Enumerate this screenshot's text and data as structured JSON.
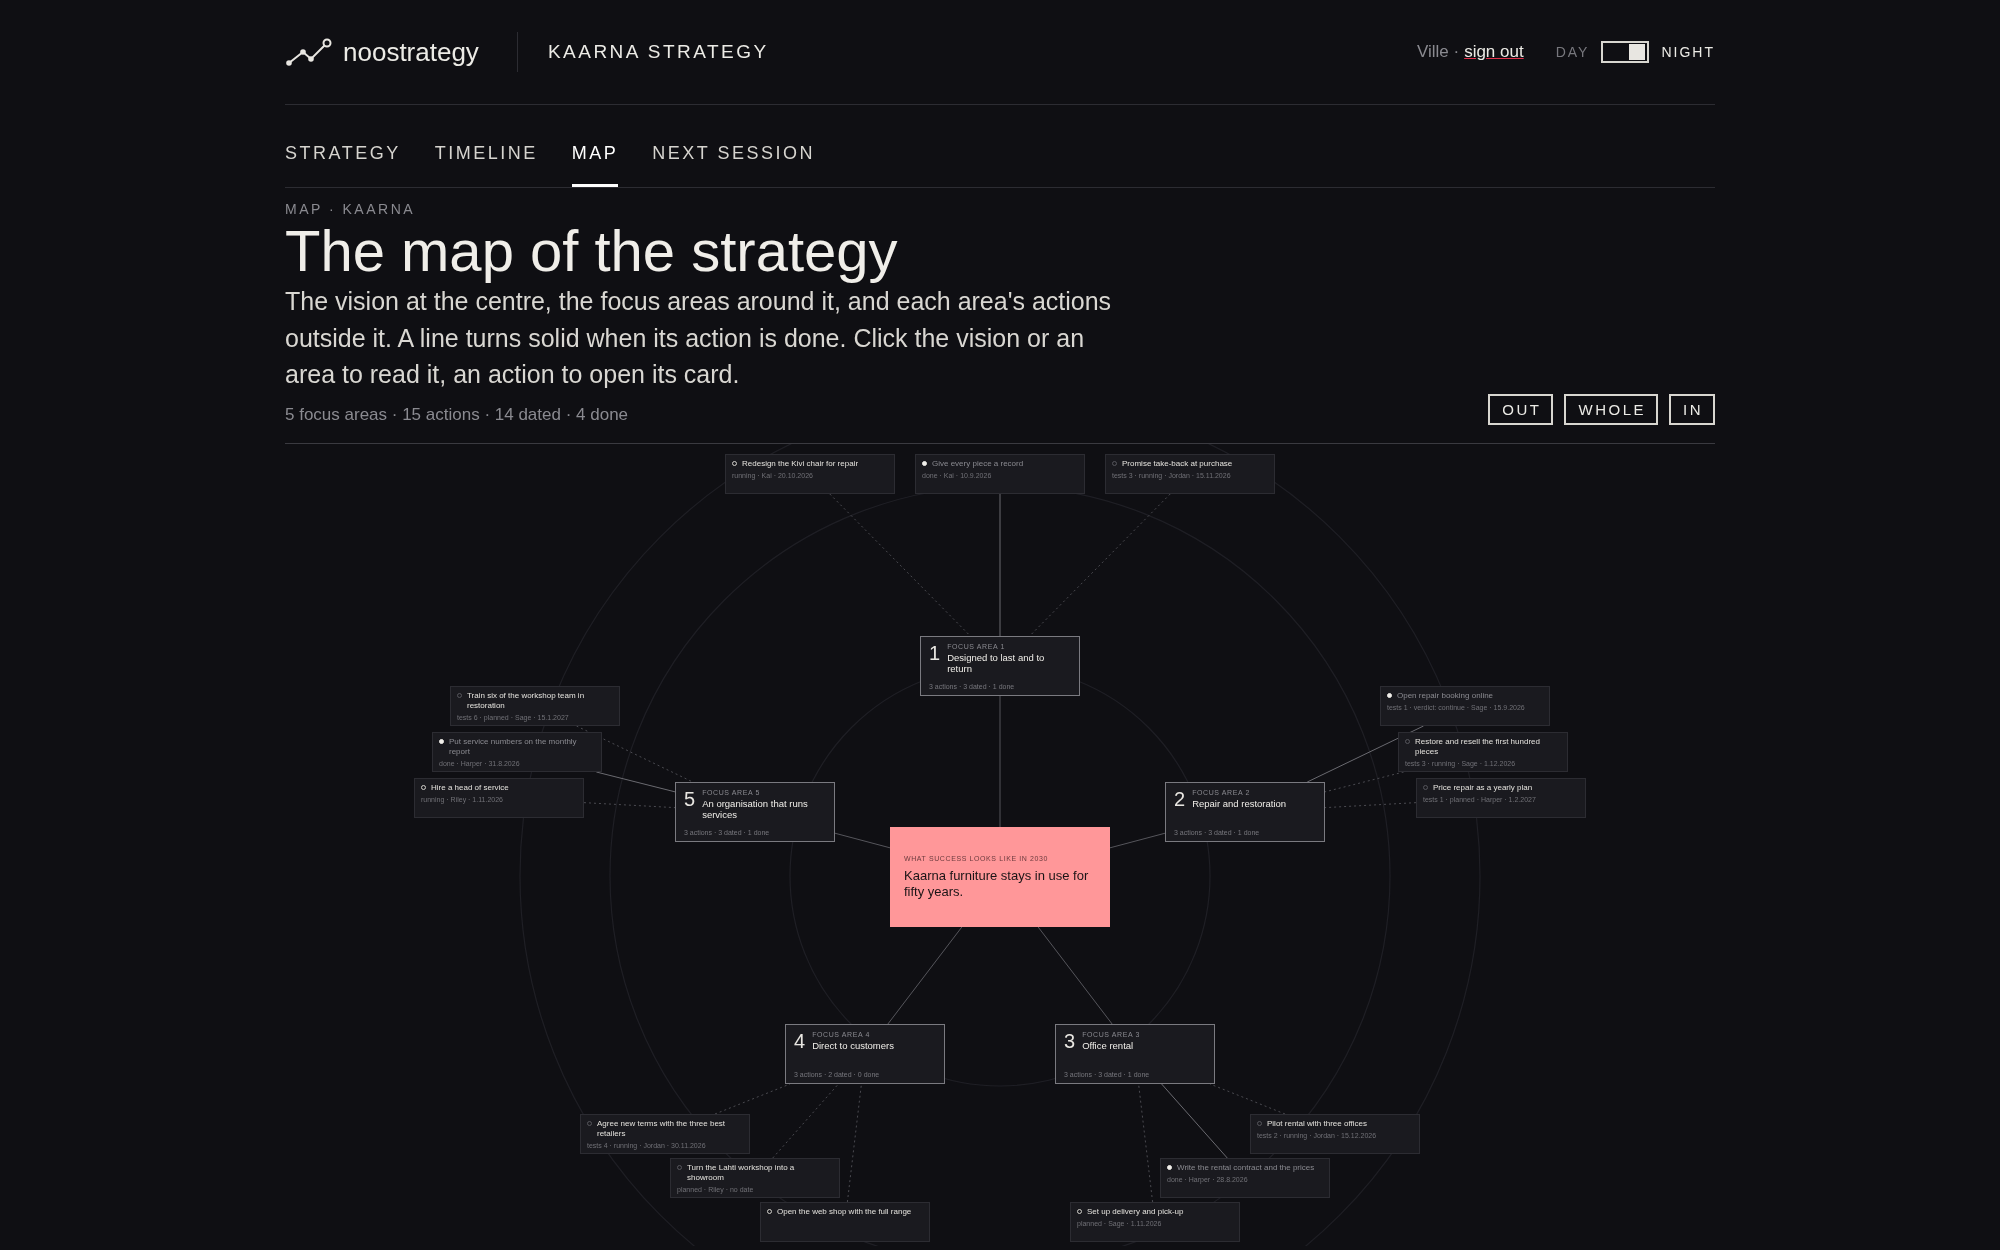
{
  "header": {
    "brand": "noostrategy",
    "workspace": "KAARNA STRATEGY",
    "user": "Ville ·",
    "sign_out": "sign out",
    "theme": {
      "day_label": "DAY",
      "night_label": "NIGHT",
      "night": true
    }
  },
  "tabs": [
    {
      "label": "STRATEGY",
      "selected": false
    },
    {
      "label": "TIMELINE",
      "selected": false
    },
    {
      "label": "MAP",
      "selected": true
    },
    {
      "label": "NEXT SESSION",
      "selected": false
    }
  ],
  "page": {
    "eyebrow": "MAP · KAARNA",
    "title": "The map of the strategy",
    "intro": "The vision at the centre, the focus areas around it, and each area's actions outside it. A line turns solid when its action is done. Click the vision or an area to read it, an action to open its card.",
    "stats": "5 focus areas · 15 actions · 14 dated · 4 done"
  },
  "zoom_buttons": [
    "OUT",
    "WHOLE",
    "IN"
  ],
  "map": {
    "vision": {
      "eyebrow": "WHAT SUCCESS LOOKS LIKE IN 2030",
      "text": "Kaarna furniture stays in use for fifty years."
    },
    "areas": [
      {
        "number": "1",
        "eyebrow": "FOCUS AREA 1",
        "title": "Designed to last and to return",
        "summary": "3 actions · 3 dated · 1 done",
        "actions": [
          {
            "title": "Redesign the Kivi chair for repair",
            "meta": "running · Kai · 20.10.2026",
            "done": false,
            "highlighted": true
          },
          {
            "title": "Give every piece a record",
            "meta": "done · Kai · 10.9.2026",
            "done": true,
            "highlighted": false
          },
          {
            "title": "Promise take-back at purchase",
            "meta": "tests 3 · running · Jordan · 15.11.2026",
            "done": false,
            "highlighted": false
          }
        ]
      },
      {
        "number": "5",
        "eyebrow": "FOCUS AREA 5",
        "title": "An organisation that runs services",
        "summary": "3 actions · 3 dated · 1 done",
        "actions": [
          {
            "title": "Train six of the workshop team in restoration",
            "meta": "tests 6 · planned · Sage · 15.1.2027",
            "done": false,
            "highlighted": false
          },
          {
            "title": "Put service numbers on the monthly report",
            "meta": "done · Harper · 31.8.2026",
            "done": true,
            "highlighted": false
          },
          {
            "title": "Hire a head of service",
            "meta": "running · Riley · 1.11.2026",
            "done": false,
            "highlighted": true
          }
        ]
      },
      {
        "number": "2",
        "eyebrow": "FOCUS AREA 2",
        "title": "Repair and restoration",
        "summary": "3 actions · 3 dated · 1 done",
        "actions": [
          {
            "title": "Open repair booking online",
            "meta": "tests 1 · verdict: continue · Sage · 15.9.2026",
            "done": true,
            "highlighted": false
          },
          {
            "title": "Restore and resell the first hundred pieces",
            "meta": "tests 3 · running · Sage · 1.12.2026",
            "done": false,
            "highlighted": false
          },
          {
            "title": "Price repair as a yearly plan",
            "meta": "tests 1 · planned · Harper · 1.2.2027",
            "done": false,
            "highlighted": false
          }
        ]
      },
      {
        "number": "4",
        "eyebrow": "FOCUS AREA 4",
        "title": "Direct to customers",
        "summary": "3 actions · 2 dated · 0 done",
        "actions": [
          {
            "title": "Agree new terms with the three best retailers",
            "meta": "tests 4 · running · Jordan · 30.11.2026",
            "done": false,
            "highlighted": false
          },
          {
            "title": "Turn the Lahti workshop into a showroom",
            "meta": "planned · Riley · no date",
            "done": false,
            "highlighted": false
          },
          {
            "title": "Open the web shop with the full range",
            "done": false,
            "highlighted": true
          }
        ]
      },
      {
        "number": "3",
        "eyebrow": "FOCUS AREA 3",
        "title": "Office rental",
        "summary": "3 actions · 3 dated · 1 done",
        "actions": [
          {
            "title": "Pilot rental with three offices",
            "meta": "tests 2 · running · Jordan · 15.12.2026",
            "done": false,
            "highlighted": false
          },
          {
            "title": "Write the rental contract and the prices",
            "meta": "done · Harper · 28.8.2026",
            "done": true,
            "highlighted": false
          },
          {
            "title": "Set up delivery and pick-up",
            "meta": "planned · Sage · 1.11.2026",
            "done": false,
            "highlighted": true
          }
        ]
      }
    ]
  }
}
